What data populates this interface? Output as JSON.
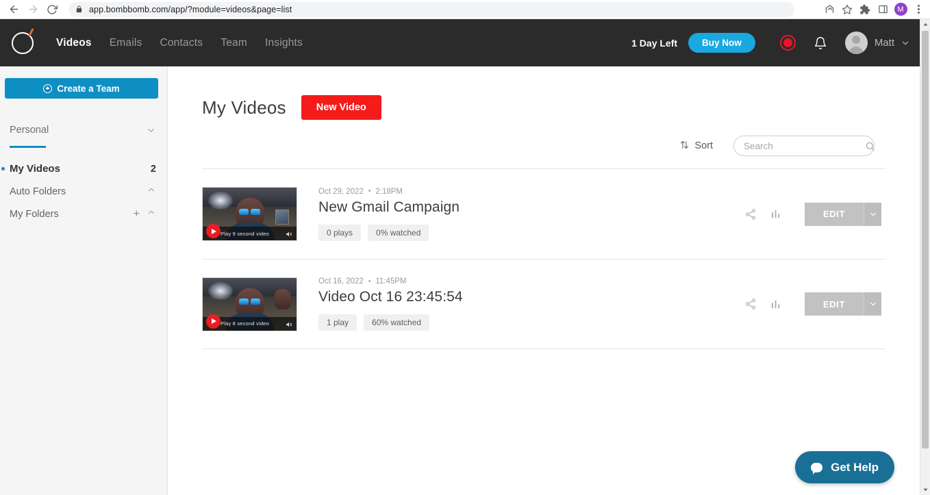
{
  "browser": {
    "url": "app.bombbomb.com/app/?module=videos&page=list",
    "back_icon": "back-arrow-icon",
    "forward_icon": "forward-arrow-icon",
    "reload_icon": "reload-icon",
    "lock_icon": "lock-icon",
    "share_icon": "share-icon",
    "bookmark_icon": "star-icon",
    "extensions_icon": "puzzle-piece-icon",
    "sidepanel_icon": "side-panel-icon",
    "profile_initial": "M",
    "menu_icon": "kebab-menu-icon"
  },
  "app_header": {
    "logo": "bombbomb-logo",
    "nav": [
      {
        "label": "Videos",
        "active": true
      },
      {
        "label": "Emails",
        "active": false
      },
      {
        "label": "Contacts",
        "active": false
      },
      {
        "label": "Team",
        "active": false
      },
      {
        "label": "Insights",
        "active": false
      }
    ],
    "trial_text": "1 Day Left",
    "buy_now_label": "Buy Now",
    "record_icon": "record-button-icon",
    "notifications_icon": "bell-icon",
    "user_name": "Matt",
    "accent_blue": "#19a8e0"
  },
  "sidebar": {
    "create_team_label": "Create a Team",
    "workspace_label": "Personal",
    "items": [
      {
        "label": "My Videos",
        "count": "2"
      },
      {
        "label": "Auto Folders",
        "count": ""
      },
      {
        "label": "My Folders",
        "count": ""
      }
    ]
  },
  "main": {
    "page_title": "My Videos",
    "new_video_label": "New Video",
    "sort_label": "Sort",
    "search_placeholder": "Search",
    "search_value": "",
    "edit_label": "EDIT",
    "videos": [
      {
        "date": "Oct 29, 2022",
        "separator": "•",
        "time": "2:18PM",
        "title": "New Gmail Campaign",
        "plays": "0 plays",
        "watched": "0% watched",
        "thumb_caption": "Play 9 second video"
      },
      {
        "date": "Oct 16, 2022",
        "separator": "•",
        "time": "11:45PM",
        "title": "Video Oct 16 23:45:54",
        "plays": "1 play",
        "watched": "60% watched",
        "thumb_caption": "Play 8 second video"
      }
    ]
  },
  "help_widget": {
    "label": "Get Help",
    "color": "#1a6f96"
  }
}
